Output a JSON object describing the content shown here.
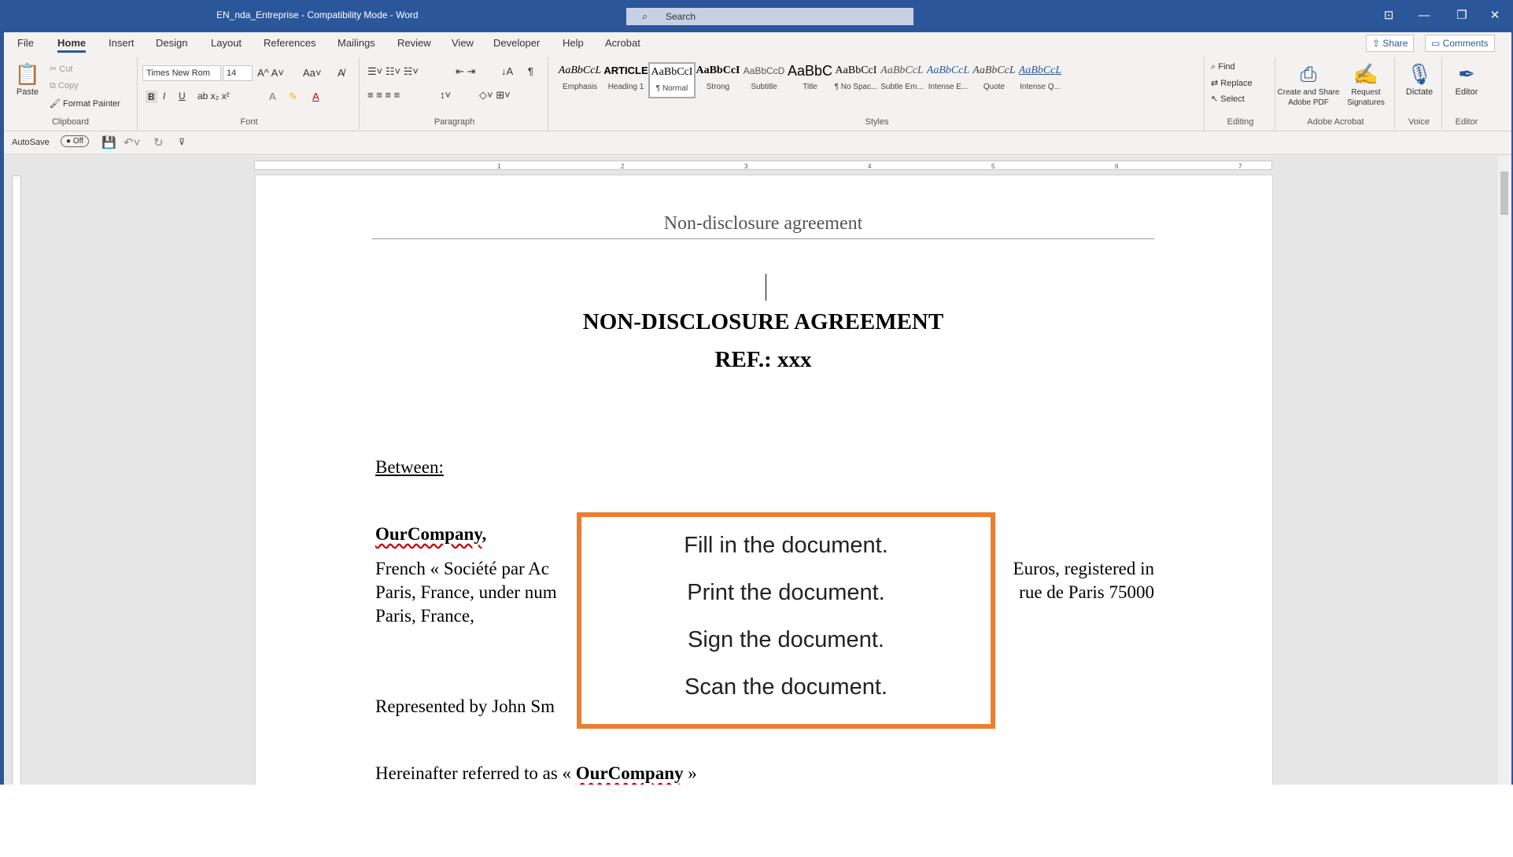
{
  "window": {
    "title": "EN_nda_Entreprise  -  Compatibility Mode  -  Word",
    "search_placeholder": "Search",
    "controls": [
      "⊡",
      "—",
      "❐",
      "✕"
    ]
  },
  "menu": {
    "tabs": [
      "File",
      "Home",
      "Insert",
      "Design",
      "Layout",
      "References",
      "Mailings",
      "Review",
      "View",
      "Developer",
      "Help",
      "Acrobat"
    ],
    "active": "Home",
    "share_label": "Share",
    "comments_label": "Comments"
  },
  "ribbon": {
    "clipboard": {
      "paste": "Paste",
      "cut": "Cut",
      "copy": "Copy",
      "format_painter": "Format Painter",
      "label": "Clipboard"
    },
    "font": {
      "name": "Times New Rom",
      "size": "14",
      "bold": "B",
      "italic": "I",
      "underline": "U",
      "label": "Font"
    },
    "paragraph": {
      "label": "Paragraph"
    },
    "styles": {
      "label": "Styles",
      "items": [
        {
          "preview": "AaBbCcL",
          "name": "Emphasis"
        },
        {
          "preview": "ARTICLE",
          "name": "Heading 1"
        },
        {
          "preview": "AaBbCcI",
          "name": "¶ Normal"
        },
        {
          "preview": "AaBbCcI",
          "name": "Strong"
        },
        {
          "preview": "AaBbCcD",
          "name": "Subtitle"
        },
        {
          "preview": "AaBbC",
          "name": "Title"
        },
        {
          "preview": "AaBbCcI",
          "name": "¶ No Spac..."
        },
        {
          "preview": "AaBbCcL",
          "name": "Subtle Em..."
        },
        {
          "preview": "AaBbCcL",
          "name": "Intense E..."
        },
        {
          "preview": "AaBbCcL",
          "name": "Quote"
        },
        {
          "preview": "AaBbCcL",
          "name": "Intense Q..."
        }
      ]
    },
    "editing": {
      "find": "Find",
      "replace": "Replace",
      "select": "Select",
      "label": "Editing"
    },
    "acrobat": {
      "create": "Create and Share Adobe PDF",
      "request": "Request Signatures",
      "label": "Adobe Acrobat"
    },
    "voice": {
      "dictate": "Dictate",
      "label": "Voice"
    },
    "editor": {
      "editor": "Editor",
      "label": "Editor"
    }
  },
  "qat": {
    "autosave": "AutoSave",
    "toggle": "Off"
  },
  "ruler": {
    "numbers": [
      "1",
      "2",
      "3",
      "4",
      "5",
      "6",
      "7"
    ]
  },
  "document": {
    "header": "Non-disclosure agreement",
    "title": "NON-DISCLOSURE AGREEMENT",
    "ref_label": "REF.:",
    "ref_value": "xxx",
    "between": "Between:",
    "company": "OurCompany",
    "company_comma": ",",
    "line1_left": "French « Société par Ac",
    "line1_right": "Euros, registered in",
    "line2_left": "Paris, France, under num",
    "line2_right": "rue de Paris 75000",
    "line3": "Paris, France,",
    "represented": "Represented by John Sm",
    "hereinafter_prefix": "Hereinafter referred to as «",
    "hereinafter_name": "OurCompany",
    "hereinafter_suffix": "»"
  },
  "popup": {
    "steps": [
      "Fill in the document.",
      "Print the document.",
      "Sign the document.",
      "Scan the document."
    ],
    "border_color": "#ed7d31"
  }
}
